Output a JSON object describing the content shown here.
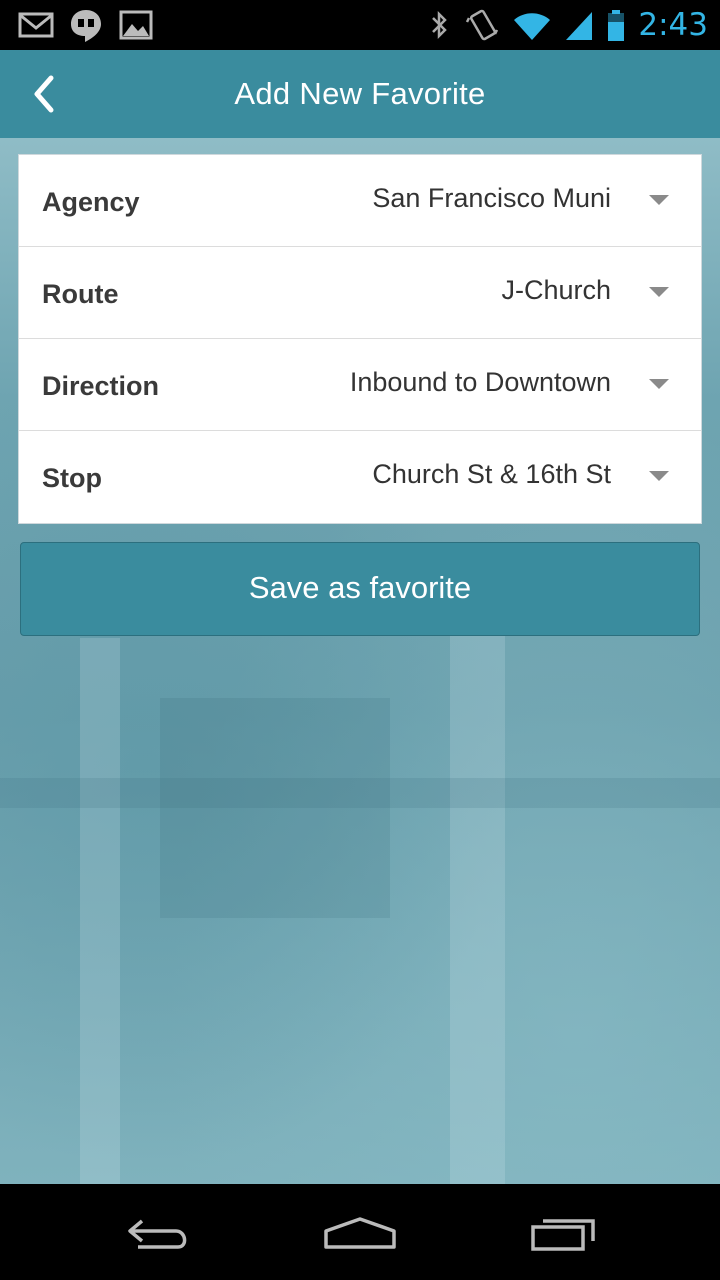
{
  "status_bar": {
    "time": "2:43",
    "icons": [
      "gmail-icon",
      "hangouts-icon",
      "gallery-icon",
      "bluetooth-icon",
      "vibrate-icon",
      "wifi-icon",
      "cell-signal-icon",
      "battery-icon"
    ]
  },
  "app_bar": {
    "title": "Add New Favorite",
    "back_icon": "chevron-left-icon"
  },
  "form": {
    "rows": [
      {
        "label": "Agency",
        "value": "San Francisco Muni"
      },
      {
        "label": "Route",
        "value": "J-Church"
      },
      {
        "label": "Direction",
        "value": "Inbound to Downtown"
      },
      {
        "label": "Stop",
        "value": "Church St & 16th St"
      }
    ]
  },
  "save_button": {
    "label": "Save as favorite"
  },
  "nav_bar": {
    "icons": [
      "back-icon",
      "home-icon",
      "recents-icon"
    ]
  },
  "colors": {
    "accent": "#3a8c9e",
    "status_time": "#33b5e5",
    "card_bg": "#ffffff",
    "label_text": "#3a3a3a"
  }
}
